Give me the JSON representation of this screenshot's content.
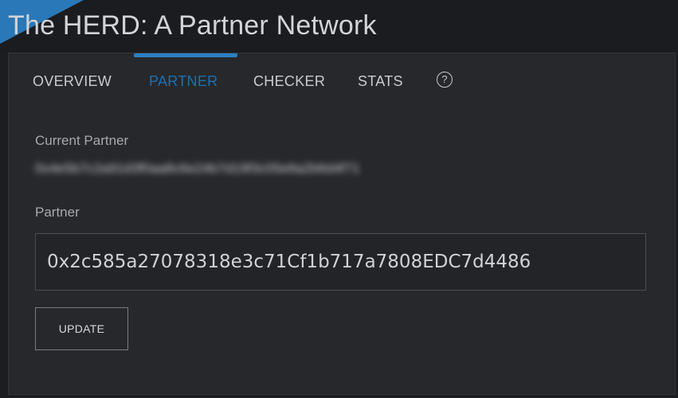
{
  "header": {
    "title": "The HERD: A Partner Network",
    "accent_color": "#2a78b8"
  },
  "tabs": [
    {
      "label": "OVERVIEW",
      "active": false
    },
    {
      "label": "PARTNER",
      "active": true
    },
    {
      "label": "CHECKER",
      "active": false
    },
    {
      "label": "STATS",
      "active": false
    }
  ],
  "help_icon": {
    "symbol": "?",
    "name": "help-icon"
  },
  "current_partner": {
    "label": "Current Partner",
    "value": "0x4e5b7c2a91d3f0aa8c6e24b7d19f3c05e8a2b6d4f71"
  },
  "partner_field": {
    "label": "Partner",
    "value": "0x2c585a27078318e3c71Cf1b717a7808EDC7d4486"
  },
  "update_button": {
    "label": "UPDATE"
  },
  "colors": {
    "active_tab": "#1f6fae",
    "tab_indicator": "#2b80c4",
    "background": "#1c1d20",
    "panel": "#27282b"
  }
}
